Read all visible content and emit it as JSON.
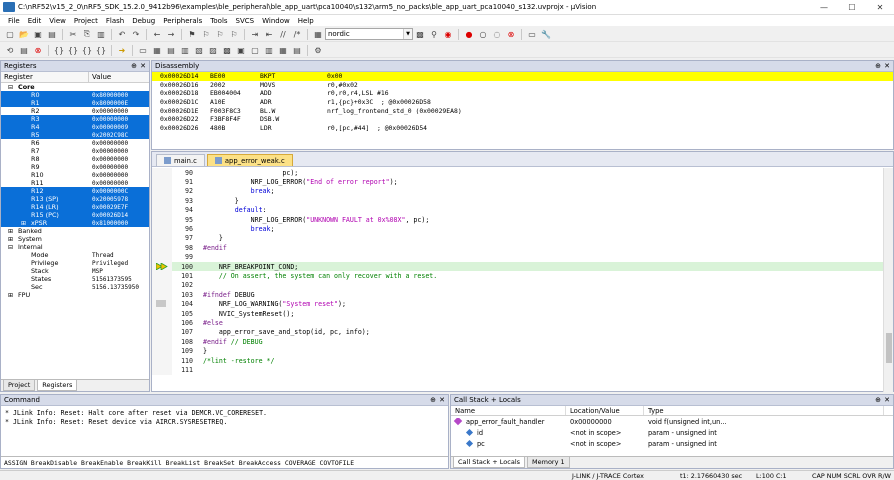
{
  "window": {
    "title": "C:\\nRF52\\v15_2_0\\nRF5_SDK_15.2.0_9412b96\\examples\\ble_peripheral\\ble_app_uart\\pca10040\\s132\\arm5_no_packs\\ble_app_uart_pca10040_s132.uvprojx - µVision",
    "minimize": "—",
    "maximize": "☐",
    "close": "✕"
  },
  "menu": [
    "File",
    "Edit",
    "View",
    "Project",
    "Flash",
    "Debug",
    "Peripherals",
    "Tools",
    "SVCS",
    "Window",
    "Help"
  ],
  "toolbar": {
    "find_combo": "nordic",
    "icons": [
      "new-file-icon",
      "open-icon",
      "save-icon",
      "save-all-icon",
      "cut-icon",
      "copy-icon",
      "paste-icon",
      "undo-icon",
      "redo-icon",
      "back-icon",
      "forward-icon",
      "bookmark-icon",
      "indent-icon",
      "outdent-icon",
      "comment-icon",
      "uncomment-icon",
      "find-combo",
      "find-icon",
      "debug-icon",
      "breakpoint-icon",
      "config-icon",
      "view-icon",
      "wrench-icon"
    ]
  },
  "registers": {
    "panel_title": "Registers",
    "col_register": "Register",
    "col_value": "Value",
    "rows": [
      {
        "name": "Core",
        "value": "",
        "kind": "grp",
        "exp": "⊟"
      },
      {
        "name": "R0",
        "value": "0x80000000",
        "kind": "sel"
      },
      {
        "name": "R1",
        "value": "0x8000000E",
        "kind": "sel"
      },
      {
        "name": "R2",
        "value": "0x00000000",
        "kind": ""
      },
      {
        "name": "R3",
        "value": "0x00000000",
        "kind": "sel"
      },
      {
        "name": "R4",
        "value": "0x00000009",
        "kind": "sel"
      },
      {
        "name": "R5",
        "value": "0x2002C98C",
        "kind": "sel"
      },
      {
        "name": "R6",
        "value": "0x00000000",
        "kind": ""
      },
      {
        "name": "R7",
        "value": "0x00000000",
        "kind": ""
      },
      {
        "name": "R8",
        "value": "0x00000000",
        "kind": ""
      },
      {
        "name": "R9",
        "value": "0x00000000",
        "kind": ""
      },
      {
        "name": "R10",
        "value": "0x00000000",
        "kind": ""
      },
      {
        "name": "R11",
        "value": "0x00000000",
        "kind": ""
      },
      {
        "name": "R12",
        "value": "0x0000000C",
        "kind": "sel"
      },
      {
        "name": "R13 (SP)",
        "value": "0x20005978",
        "kind": "sel"
      },
      {
        "name": "R14 (LR)",
        "value": "0x00029E7F",
        "kind": "sel"
      },
      {
        "name": "R15 (PC)",
        "value": "0x00026D14",
        "kind": "sel"
      },
      {
        "name": "xPSR",
        "value": "0x81000000",
        "kind": "sel",
        "exp": "⊞"
      },
      {
        "name": "Banked",
        "value": "",
        "kind": "grp2",
        "exp": "⊞"
      },
      {
        "name": "System",
        "value": "",
        "kind": "grp2",
        "exp": "⊞"
      },
      {
        "name": "Internal",
        "value": "",
        "kind": "grp2",
        "exp": "⊟"
      },
      {
        "name": "Mode",
        "value": "Thread",
        "kind": "sub"
      },
      {
        "name": "Privilege",
        "value": "Privileged",
        "kind": "sub"
      },
      {
        "name": "Stack",
        "value": "MSP",
        "kind": "sub"
      },
      {
        "name": "States",
        "value": "51561373595",
        "kind": "sub"
      },
      {
        "name": "Sec",
        "value": "5156.13735950",
        "kind": "sub"
      },
      {
        "name": "FPU",
        "value": "",
        "kind": "grp2",
        "exp": "⊞"
      }
    ],
    "tabs": [
      "Project",
      "Registers"
    ]
  },
  "disassembly": {
    "panel_title": "Disassembly",
    "lines": [
      {
        "addr": "0x00026D14",
        "hex": "BE00",
        "mn": "BKPT",
        "op": "0x00",
        "cur": true
      },
      {
        "addr": "0x00026D16",
        "hex": "2002",
        "mn": "MOVS",
        "op": "r0,#0x02",
        "cur": false
      },
      {
        "addr": "0x00026D18",
        "hex": "EB004004",
        "mn": "ADD",
        "op": "r0,r0,r4,LSL #16",
        "cur": false
      },
      {
        "addr": "0x00026D1C",
        "hex": "A10E",
        "mn": "ADR",
        "op": "r1,{pc}+0x3C  ; @0x00026D58",
        "cur": false
      },
      {
        "addr": "0x00026D1E",
        "hex": "F003F8C3",
        "mn": "BL.W",
        "op": "nrf_log_frontend_std_0 (0x00029EA8)",
        "cur": false
      },
      {
        "addr": "0x00026D22",
        "hex": "F3BF8F4F",
        "mn": "DSB.W",
        "op": "",
        "cur": false
      },
      {
        "addr": "0x00026D26",
        "hex": "480B",
        "mn": "LDR",
        "op": "r0,[pc,#44]  ; @0x00026D54",
        "cur": false
      }
    ]
  },
  "editor": {
    "tabs": [
      {
        "label": "main.c",
        "active": false
      },
      {
        "label": "app_error_weak.c",
        "active": true
      }
    ],
    "lines": [
      {
        "n": "90",
        "mark": "",
        "hl": false,
        "segs": [
          {
            "t": "                    pc);",
            "c": ""
          }
        ]
      },
      {
        "n": "91",
        "mark": "",
        "hl": false,
        "segs": [
          {
            "t": "            NRF_LOG_ERROR(",
            "c": ""
          },
          {
            "t": "\"End of error report\"",
            "c": "str"
          },
          {
            "t": ");",
            "c": ""
          }
        ]
      },
      {
        "n": "92",
        "mark": "",
        "hl": false,
        "segs": [
          {
            "t": "            ",
            "c": ""
          },
          {
            "t": "break",
            "c": "kw"
          },
          {
            "t": ";",
            "c": ""
          }
        ]
      },
      {
        "n": "93",
        "mark": "",
        "hl": false,
        "segs": [
          {
            "t": "        }",
            "c": ""
          }
        ]
      },
      {
        "n": "94",
        "mark": "",
        "hl": false,
        "segs": [
          {
            "t": "        ",
            "c": ""
          },
          {
            "t": "default",
            "c": "kw"
          },
          {
            "t": ":",
            "c": ""
          }
        ]
      },
      {
        "n": "95",
        "mark": "",
        "hl": false,
        "segs": [
          {
            "t": "            NRF_LOG_ERROR(",
            "c": ""
          },
          {
            "t": "\"UNKNOWN FAULT at 0x%08X\"",
            "c": "str"
          },
          {
            "t": ", pc);",
            "c": ""
          }
        ]
      },
      {
        "n": "96",
        "mark": "",
        "hl": false,
        "segs": [
          {
            "t": "            ",
            "c": ""
          },
          {
            "t": "break",
            "c": "kw"
          },
          {
            "t": ";",
            "c": ""
          }
        ]
      },
      {
        "n": "97",
        "mark": "",
        "hl": false,
        "segs": [
          {
            "t": "    }",
            "c": ""
          }
        ]
      },
      {
        "n": "98",
        "mark": "",
        "hl": false,
        "segs": [
          {
            "t": "#endif",
            "c": "pp"
          }
        ]
      },
      {
        "n": "99",
        "mark": "",
        "hl": false,
        "segs": [
          {
            "t": "",
            "c": ""
          }
        ]
      },
      {
        "n": "100",
        "mark": "arrow",
        "hl": true,
        "segs": [
          {
            "t": "    NRF_BREAKPOINT_COND;",
            "c": ""
          }
        ]
      },
      {
        "n": "101",
        "mark": "",
        "hl": false,
        "segs": [
          {
            "t": "    ",
            "c": ""
          },
          {
            "t": "// On assert, the system can only recover with a reset.",
            "c": "cm"
          }
        ]
      },
      {
        "n": "102",
        "mark": "",
        "hl": false,
        "segs": [
          {
            "t": "",
            "c": ""
          }
        ]
      },
      {
        "n": "103",
        "mark": "",
        "hl": false,
        "segs": [
          {
            "t": "#ifndef",
            "c": "pp"
          },
          {
            "t": " DEBUG",
            "c": ""
          }
        ]
      },
      {
        "n": "104",
        "mark": "gray",
        "hl": false,
        "segs": [
          {
            "t": "    NRF_LOG_WARNING(",
            "c": ""
          },
          {
            "t": "\"System reset\"",
            "c": "str"
          },
          {
            "t": ");",
            "c": ""
          }
        ]
      },
      {
        "n": "105",
        "mark": "",
        "hl": false,
        "segs": [
          {
            "t": "    NVIC_SystemReset();",
            "c": ""
          }
        ]
      },
      {
        "n": "106",
        "mark": "",
        "hl": false,
        "segs": [
          {
            "t": "#else",
            "c": "pp"
          }
        ]
      },
      {
        "n": "107",
        "mark": "",
        "hl": false,
        "segs": [
          {
            "t": "    app_error_save_and_stop(id, pc, info);",
            "c": ""
          }
        ]
      },
      {
        "n": "108",
        "mark": "",
        "hl": false,
        "segs": [
          {
            "t": "#endif",
            "c": "pp"
          },
          {
            "t": " // DEBUG",
            "c": "cm"
          }
        ]
      },
      {
        "n": "109",
        "mark": "",
        "hl": false,
        "segs": [
          {
            "t": "}",
            "c": ""
          }
        ]
      },
      {
        "n": "110",
        "mark": "",
        "hl": false,
        "segs": [
          {
            "t": "/*lint -restore */",
            "c": "cm"
          }
        ]
      },
      {
        "n": "111",
        "mark": "",
        "hl": false,
        "segs": [
          {
            "t": "",
            "c": ""
          }
        ]
      }
    ]
  },
  "command": {
    "panel_title": "Command",
    "lines": [
      "* JLink Info: Reset: Halt core after reset via DEMCR.VC_CORERESET.",
      "* JLink Info: Reset: Reset device via AIRCR.SYSRESETREQ."
    ],
    "input": "ASSIGN BreakDisable BreakEnable BreakKill BreakList BreakSet BreakAccess COVERAGE COVTOFILE"
  },
  "callstack": {
    "panel_title": "Call Stack + Locals",
    "col_name": "Name",
    "col_location": "Location/Value",
    "col_type": "Type",
    "rows": [
      {
        "name": "app_error_fault_handler",
        "loc": "0x00000000",
        "type": "void f(unsigned int,un..."
      },
      {
        "name": "id",
        "loc": "<not in scope>",
        "type": "param - unsigned int"
      },
      {
        "name": "pc",
        "loc": "<not in scope>",
        "type": "param - unsigned int"
      }
    ],
    "tabs": [
      "Call Stack + Locals",
      "Memory 1"
    ]
  },
  "status": {
    "debugger": "J-LINK / J-TRACE Cortex",
    "time": "t1: 2.17660430 sec",
    "pos": "L:100 C:1",
    "flags": "CAP  NUM  SCRL  OVR  R/W"
  }
}
